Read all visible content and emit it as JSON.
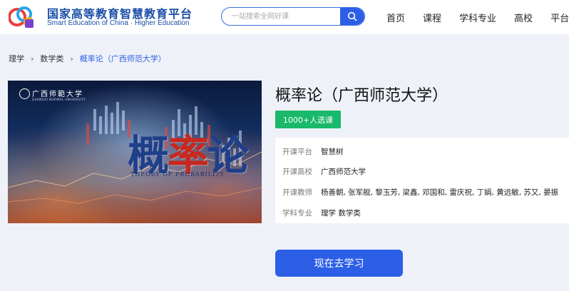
{
  "header": {
    "brand_cn": "国家高等教育智慧教育平台",
    "brand_en": "Smart Education of China · Higher Education",
    "search_placeholder": "一站搜索全网好课",
    "nav": [
      "首页",
      "课程",
      "学科专业",
      "高校",
      "平台"
    ]
  },
  "breadcrumb": [
    "理学",
    "数学类",
    "概率论（广西师范大学）"
  ],
  "cover": {
    "university": "广西师範大学",
    "university_en": "GUANGXI NORMAL UNIVERSITY",
    "title_part1": "概",
    "title_part2": "率",
    "title_part3": "论",
    "subtitle": "THEORY OF PROBABILITY"
  },
  "course": {
    "title": "概率论（广西师范大学）",
    "enroll_badge": "1000+人选课",
    "info": [
      {
        "label": "开课平台",
        "value": "智慧树"
      },
      {
        "label": "开课高校",
        "value": "广西师范大学"
      },
      {
        "label": "开课教师",
        "value": "杨善朝, 张军舰, 黎玉芳, 梁鑫, 邓国和, 雷庆祝, 丁娟, 黄远敏, 苏又, 晏振"
      },
      {
        "label": "学科专业",
        "value": "理学 数学类"
      }
    ],
    "cta": "现在去学习"
  },
  "colors": {
    "primary": "#2d5fe6",
    "badge_green": "#19b86a",
    "brand_blue": "#1b4ea8",
    "background": "#eef2f8"
  }
}
